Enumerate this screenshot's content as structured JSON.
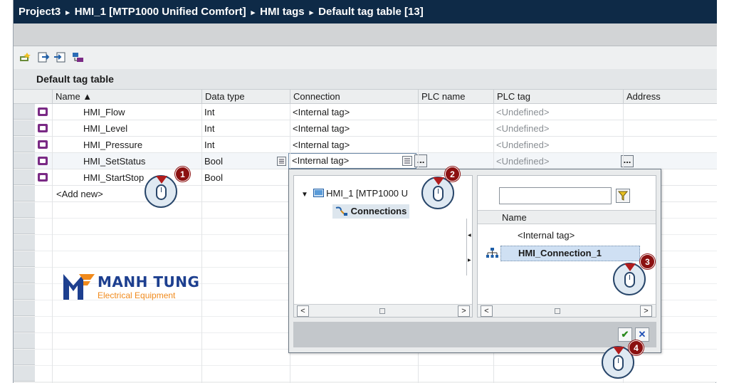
{
  "titlebar": {
    "crumbs": [
      "Project3",
      "HMI_1 [MTP1000 Unified Comfort]",
      "HMI tags",
      "Default tag table [13]"
    ],
    "separator": "▸"
  },
  "toolbar": {
    "icons": [
      "add-tag-icon",
      "export-icon",
      "import-icon",
      "monitor-icon"
    ]
  },
  "table": {
    "title": "Default tag table",
    "columns": [
      "Name ▲",
      "Data type",
      "Connection",
      "PLC name",
      "PLC tag",
      "Address"
    ],
    "rows": [
      {
        "name": "HMI_Flow",
        "type": "Int",
        "connection": "<Internal tag>",
        "plc_tag": "<Undefined>"
      },
      {
        "name": "HMI_Level",
        "type": "Int",
        "connection": "<Internal tag>",
        "plc_tag": "<Undefined>"
      },
      {
        "name": "HMI_Pressure",
        "type": "Int",
        "connection": "<Internal tag>",
        "plc_tag": "<Undefined>"
      },
      {
        "name": "HMI_SetStatus",
        "type": "Bool",
        "connection": "<Internal tag>",
        "plc_tag": "<Undefined>"
      },
      {
        "name": "HMI_StartStop",
        "type": "Bool",
        "connection": "",
        "plc_tag": ""
      }
    ],
    "add_new": "<Add new>",
    "ellipsis": "..."
  },
  "popup": {
    "tree_root": "HMI_1 [MTP1000 U",
    "tree_child": "Connections",
    "list_header": "Name",
    "list_items": [
      "<Internal tag>",
      "HMI_Connection_1"
    ],
    "ok_symbol": "✔",
    "cancel_symbol": "✕"
  },
  "steps": [
    "1",
    "2",
    "3",
    "4"
  ],
  "logo": {
    "name": "MANH TUNG",
    "sub": "Electrical Equipment"
  },
  "colors": {
    "title_bg": "#0e2a47",
    "tag_icon": "#7a2a85",
    "badge": "#8b1010",
    "selection": "#cfe0f3"
  }
}
